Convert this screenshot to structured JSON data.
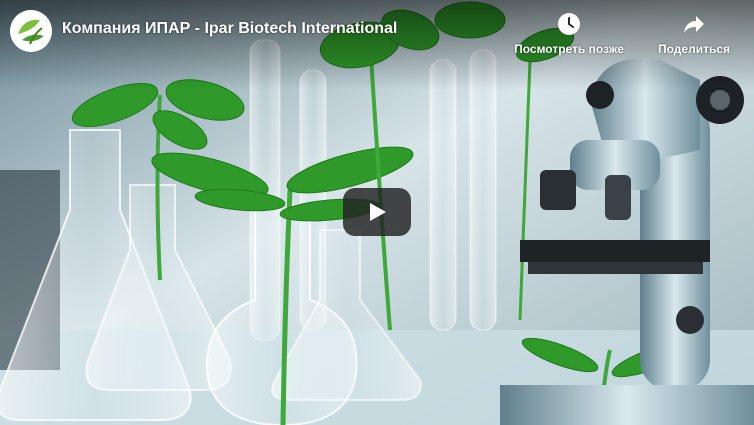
{
  "video": {
    "title": "Компания ИПАР - Ipar Biotech International"
  },
  "actions": {
    "watch_later_label": "Посмотреть позже",
    "share_label": "Поделиться"
  },
  "icons": {
    "channel_logo": "ipar-logo-icon",
    "watch_later": "clock-icon",
    "share": "share-arrow-icon",
    "play": "play-icon"
  },
  "colors": {
    "title_text": "#ffffff",
    "play_button_bg": "#212121",
    "logo_green": "#7cbf3a"
  }
}
